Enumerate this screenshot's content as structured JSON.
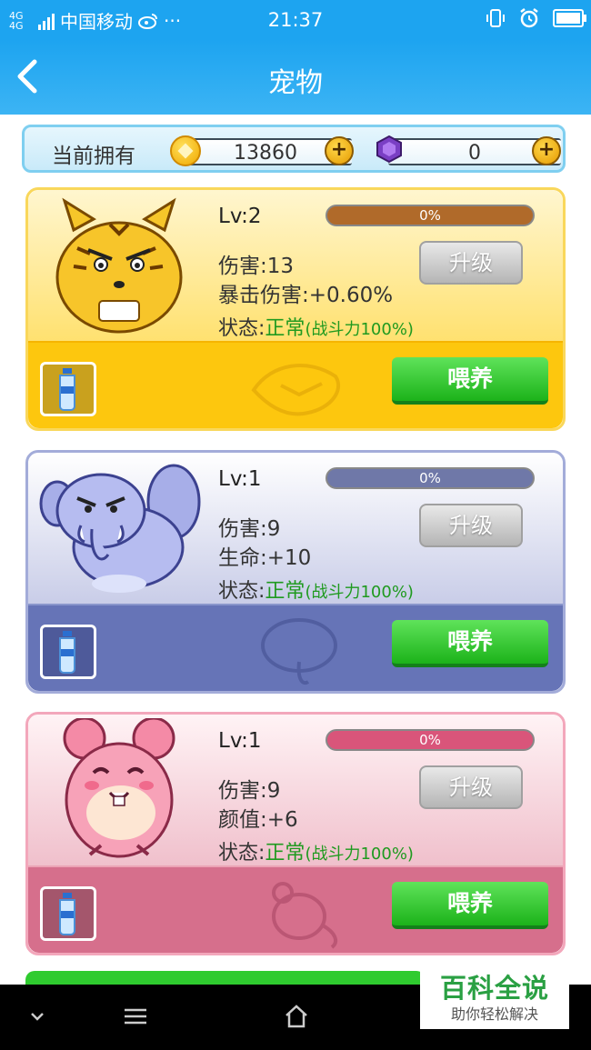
{
  "status_bar": {
    "network": "4G 4G",
    "carrier": "中国移动",
    "more": "···",
    "time": "21:37"
  },
  "header": {
    "title": "宠物"
  },
  "currency": {
    "label": "当前拥有",
    "gold": "13860",
    "gems": "0",
    "add_symbol": "+"
  },
  "pets": [
    {
      "level": "Lv:2",
      "progress_text": "0%",
      "progress": 0,
      "stat1": "伤害:13",
      "stat2": "暴击伤害:+0.60%",
      "state_label": "状态:",
      "state_value": "正常",
      "state_detail": "(战斗力100%)",
      "upgrade_label": "升级",
      "feed_label": "喂养",
      "bar_color": "#b06a2a"
    },
    {
      "level": "Lv:1",
      "progress_text": "0%",
      "progress": 0,
      "stat1": "伤害:9",
      "stat2": "生命:+10",
      "state_label": "状态:",
      "state_value": "正常",
      "state_detail": "(战斗力100%)",
      "upgrade_label": "升级",
      "feed_label": "喂养",
      "bar_color": "#6f78a8"
    },
    {
      "level": "Lv:1",
      "progress_text": "0%",
      "progress": 0,
      "stat1": "伤害:9",
      "stat2": "颜值:+6",
      "state_label": "状态:",
      "state_value": "正常",
      "state_detail": "(战斗力100%)",
      "upgrade_label": "升级",
      "feed_label": "喂养",
      "bar_color": "#d9557a"
    }
  ],
  "watermark": {
    "main": "百科全说",
    "sub": "助你轻松解决"
  }
}
